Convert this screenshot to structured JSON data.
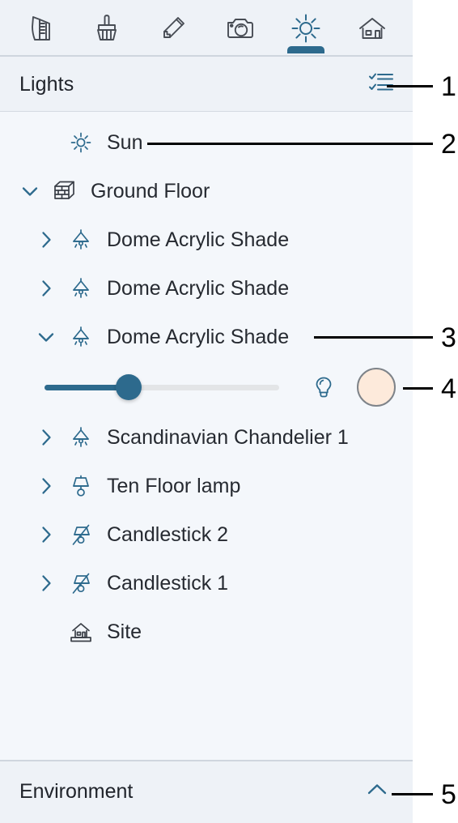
{
  "toolbar": {
    "items": [
      {
        "name": "caliper-icon",
        "label": "Measure",
        "active": false
      },
      {
        "name": "brush-icon",
        "label": "Paint",
        "active": false
      },
      {
        "name": "pencil-icon",
        "label": "Draw",
        "active": false
      },
      {
        "name": "camera-icon",
        "label": "Camera",
        "active": false
      },
      {
        "name": "sun-icon",
        "label": "Lighting",
        "active": true
      },
      {
        "name": "house-icon",
        "label": "Building",
        "active": false
      }
    ],
    "active_indicator_color": "#2d6a8d"
  },
  "lights_panel": {
    "title": "Lights",
    "list_toggle_icon": "checklist-icon",
    "tree": [
      {
        "label": "Sun",
        "icon": "sun-small-icon",
        "indent": 1,
        "chevron": "none",
        "expanded": false
      },
      {
        "label": "Ground Floor",
        "icon": "brick-cube-icon",
        "indent": 0,
        "chevron": "down",
        "expanded": true
      },
      {
        "label": "Dome Acrylic Shade",
        "icon": "pendant-lamp-icon",
        "indent": 1,
        "chevron": "right",
        "expanded": false
      },
      {
        "label": "Dome Acrylic Shade",
        "icon": "pendant-lamp-icon",
        "indent": 1,
        "chevron": "right",
        "expanded": false
      },
      {
        "label": "Dome Acrylic Shade",
        "icon": "pendant-lamp-icon",
        "indent": 1,
        "chevron": "down",
        "expanded": true
      },
      {
        "label": "Scandinavian Chandelier 1",
        "icon": "pendant-lamp-icon",
        "indent": 1,
        "chevron": "right",
        "expanded": false
      },
      {
        "label": "Ten Floor lamp",
        "icon": "floor-lamp-icon",
        "indent": 1,
        "chevron": "right",
        "expanded": false
      },
      {
        "label": "Candlestick 2",
        "icon": "lamp-off-icon",
        "indent": 1,
        "chevron": "right",
        "expanded": false
      },
      {
        "label": "Candlestick 1",
        "icon": "lamp-off-icon",
        "indent": 1,
        "chevron": "right",
        "expanded": false
      },
      {
        "label": "Site",
        "icon": "site-house-icon",
        "indent": 1,
        "chevron": "none",
        "expanded": false
      }
    ],
    "light_controls": {
      "intensity_percent": 36,
      "slider_fill_color": "#2d6a8d",
      "slider_track_color": "#e3e5e7",
      "bulb_toggle_icon": "lightbulb-icon",
      "color_swatch_value": "#fdeadb",
      "color_swatch_border": "#7e8389"
    }
  },
  "environment_panel": {
    "title": "Environment",
    "collapse_icon": "chevron-up-icon"
  },
  "callouts": [
    {
      "number": "1"
    },
    {
      "number": "2"
    },
    {
      "number": "3"
    },
    {
      "number": "4"
    },
    {
      "number": "5"
    }
  ]
}
